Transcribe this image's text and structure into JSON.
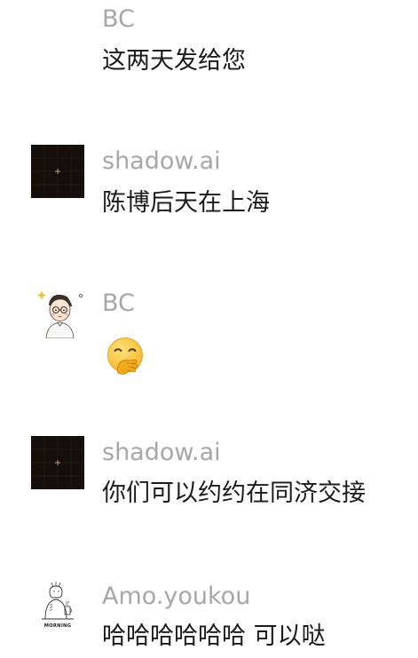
{
  "messages": [
    {
      "sender": "BC",
      "text": "这两天发给您",
      "avatar": "none"
    },
    {
      "sender": "shadow.ai",
      "text": "陈博后天在上海",
      "avatar": "dark-grid-icon"
    },
    {
      "sender": "BC",
      "text": "",
      "avatar": "cartoon-man-icon",
      "emoji": "hand-over-mouth-emoji"
    },
    {
      "sender": "shadow.ai",
      "text": "你们可以约约在同济交接",
      "avatar": "dark-grid-icon"
    },
    {
      "sender": "Amo.youkou",
      "text": "哈哈哈哈哈哈 可以哒",
      "avatar": "morning-sketch-icon",
      "avatar_caption": "MORNING"
    }
  ]
}
